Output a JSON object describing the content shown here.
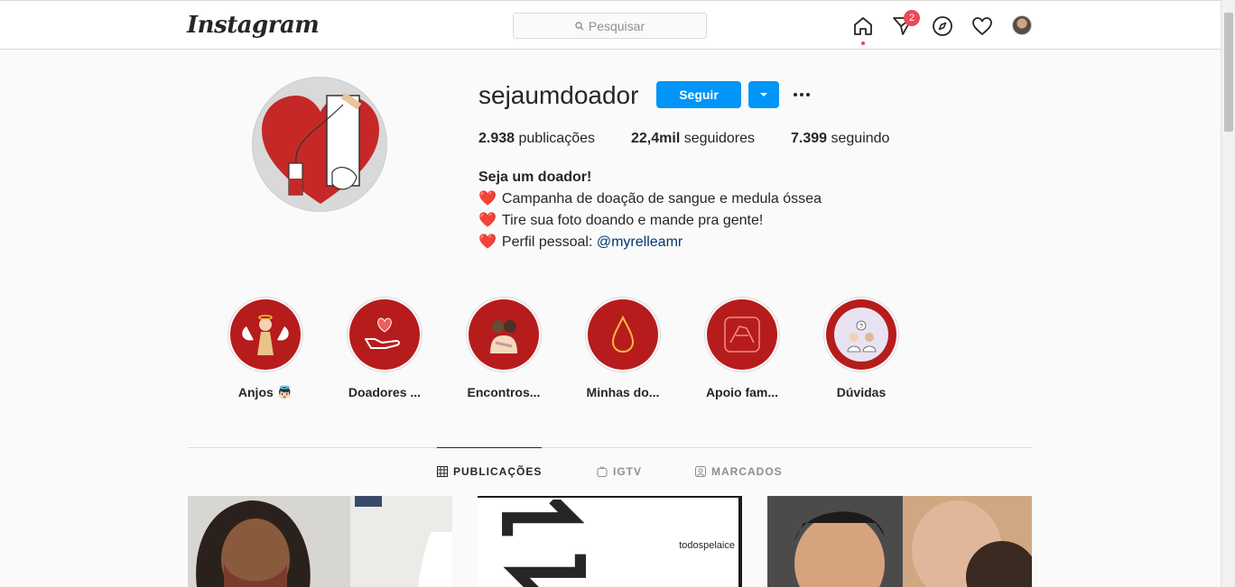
{
  "nav": {
    "logo": "Instagram",
    "search_placeholder": "Pesquisar",
    "direct_badge": "2"
  },
  "profile": {
    "username": "sejaumdoador",
    "follow_label": "Seguir",
    "stats": {
      "posts_count": "2.938",
      "posts_label": "publicações",
      "followers_count": "22,4mil",
      "followers_label": "seguidores",
      "following_count": "7.399",
      "following_label": "seguindo"
    },
    "bio": {
      "name": "Seja um doador!",
      "line1": "Campanha de doação de sangue e medula óssea",
      "line2": "Tire sua foto doando e mande pra gente!",
      "line3_prefix": "Perfil pessoal: ",
      "line3_link": "@myrelleamr",
      "heart": "❤️"
    }
  },
  "highlights": [
    {
      "label": "Anjos 👼🏻"
    },
    {
      "label": "Doadores ..."
    },
    {
      "label": "Encontros..."
    },
    {
      "label": "Minhas do..."
    },
    {
      "label": "Apoio fam..."
    },
    {
      "label": "Dúvidas"
    }
  ],
  "tabs": {
    "posts": "PUBLICAÇÕES",
    "igtv": "IGTV",
    "tagged": "MARCADOS"
  },
  "posts": [
    {
      "tag": ""
    },
    {
      "tag": "todospelaice"
    },
    {
      "tag": ""
    }
  ],
  "colors": {
    "accent": "#0095f6",
    "highlight_bg": "#b71c1c",
    "badge": "#ed4956",
    "link": "#00376b"
  }
}
